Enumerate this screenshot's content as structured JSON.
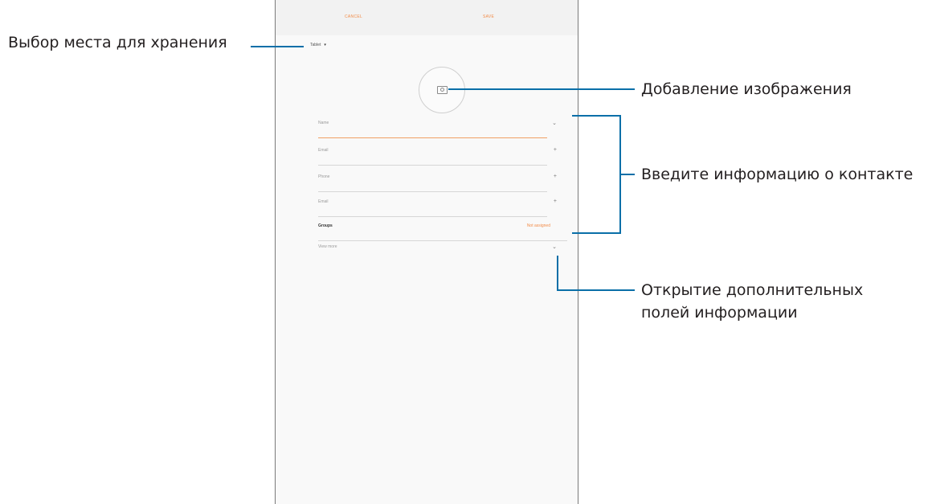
{
  "annotations": {
    "storage": "Выбор места для хранения",
    "image": "Добавление изображения",
    "contact_info": "Введите информацию о контакте",
    "more_fields_line1": "Открытие дополнительных",
    "more_fields_line2": "полей информации"
  },
  "screen": {
    "header": {
      "cancel": "CANCEL",
      "save": "SAVE"
    },
    "storage": {
      "label": "Tablet",
      "arrow": "▾"
    },
    "fields": [
      {
        "label": "Name",
        "control": "⌄"
      },
      {
        "label": "Email",
        "control": "+"
      },
      {
        "label": "Phone",
        "control": "+"
      },
      {
        "label": "Email",
        "control": "+"
      }
    ],
    "groups": {
      "label": "Groups",
      "value": "Not assigned"
    },
    "more": {
      "label": "View more",
      "control": "⌄"
    }
  },
  "colors": {
    "accent": "#f28c48",
    "leader": "#0a6fa8",
    "text": "#231f20"
  }
}
